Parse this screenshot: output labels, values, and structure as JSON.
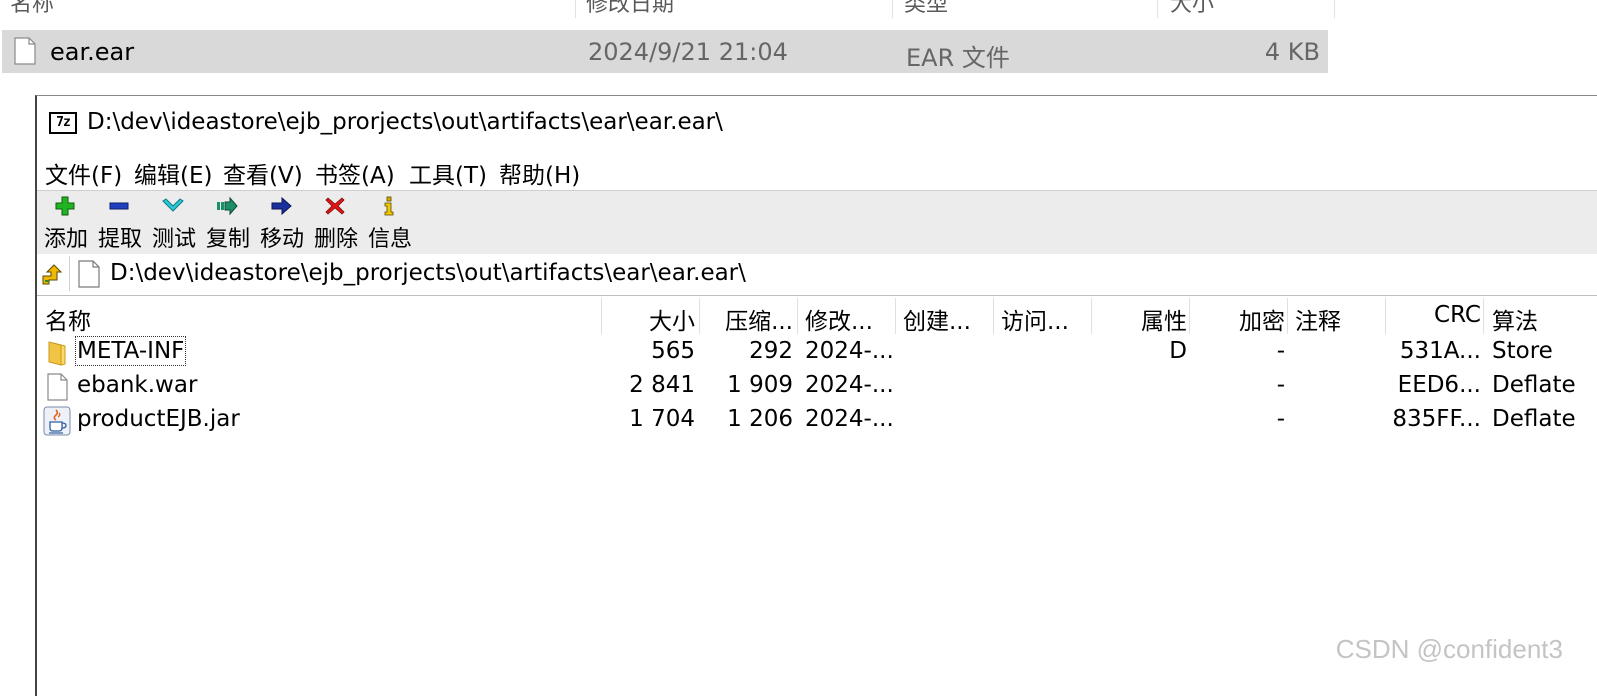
{
  "explorer": {
    "headers": [
      "名称",
      "修改日期",
      "类型",
      "大小"
    ],
    "row": {
      "name": "ear.ear",
      "date": "2024/9/21 21:04",
      "type": "EAR 文件",
      "size": "4 KB"
    }
  },
  "window": {
    "title": "D:\\dev\\ideastore\\ejb_prorjects\\out\\artifacts\\ear\\ear.ear\\",
    "menu": [
      "文件(F)",
      "编辑(E)",
      "查看(V)",
      "书签(A)",
      "工具(T)",
      "帮助(H)"
    ],
    "toolbar": [
      {
        "label": "添加",
        "icon": "add-icon"
      },
      {
        "label": "提取",
        "icon": "extract-icon"
      },
      {
        "label": "测试",
        "icon": "test-icon"
      },
      {
        "label": "复制",
        "icon": "copy-icon"
      },
      {
        "label": "移动",
        "icon": "move-icon"
      },
      {
        "label": "删除",
        "icon": "delete-icon"
      },
      {
        "label": "信息",
        "icon": "info-icon"
      }
    ],
    "address": "D:\\dev\\ideastore\\ejb_prorjects\\out\\artifacts\\ear\\ear.ear\\"
  },
  "list": {
    "columns": [
      "名称",
      "大小",
      "压缩...",
      "修改...",
      "创建...",
      "访问...",
      "属性",
      "加密",
      "注释",
      "CRC",
      "算法"
    ],
    "rows": [
      {
        "name": "META-INF",
        "icon": "folder-icon",
        "size": "565",
        "packed": "292",
        "modified": "2024-...",
        "attr": "D",
        "encrypted": "-",
        "crc": "531A...",
        "method": "Store"
      },
      {
        "name": "ebank.war",
        "icon": "file-icon",
        "size": "2 841",
        "packed": "1 909",
        "modified": "2024-...",
        "attr": "",
        "encrypted": "-",
        "crc": "EED6...",
        "method": "Deflate"
      },
      {
        "name": "productEJB.jar",
        "icon": "java-icon",
        "size": "1 704",
        "packed": "1 206",
        "modified": "2024-...",
        "attr": "",
        "encrypted": "-",
        "crc": "835FF...",
        "method": "Deflate"
      }
    ]
  },
  "watermark": "CSDN @confident3"
}
